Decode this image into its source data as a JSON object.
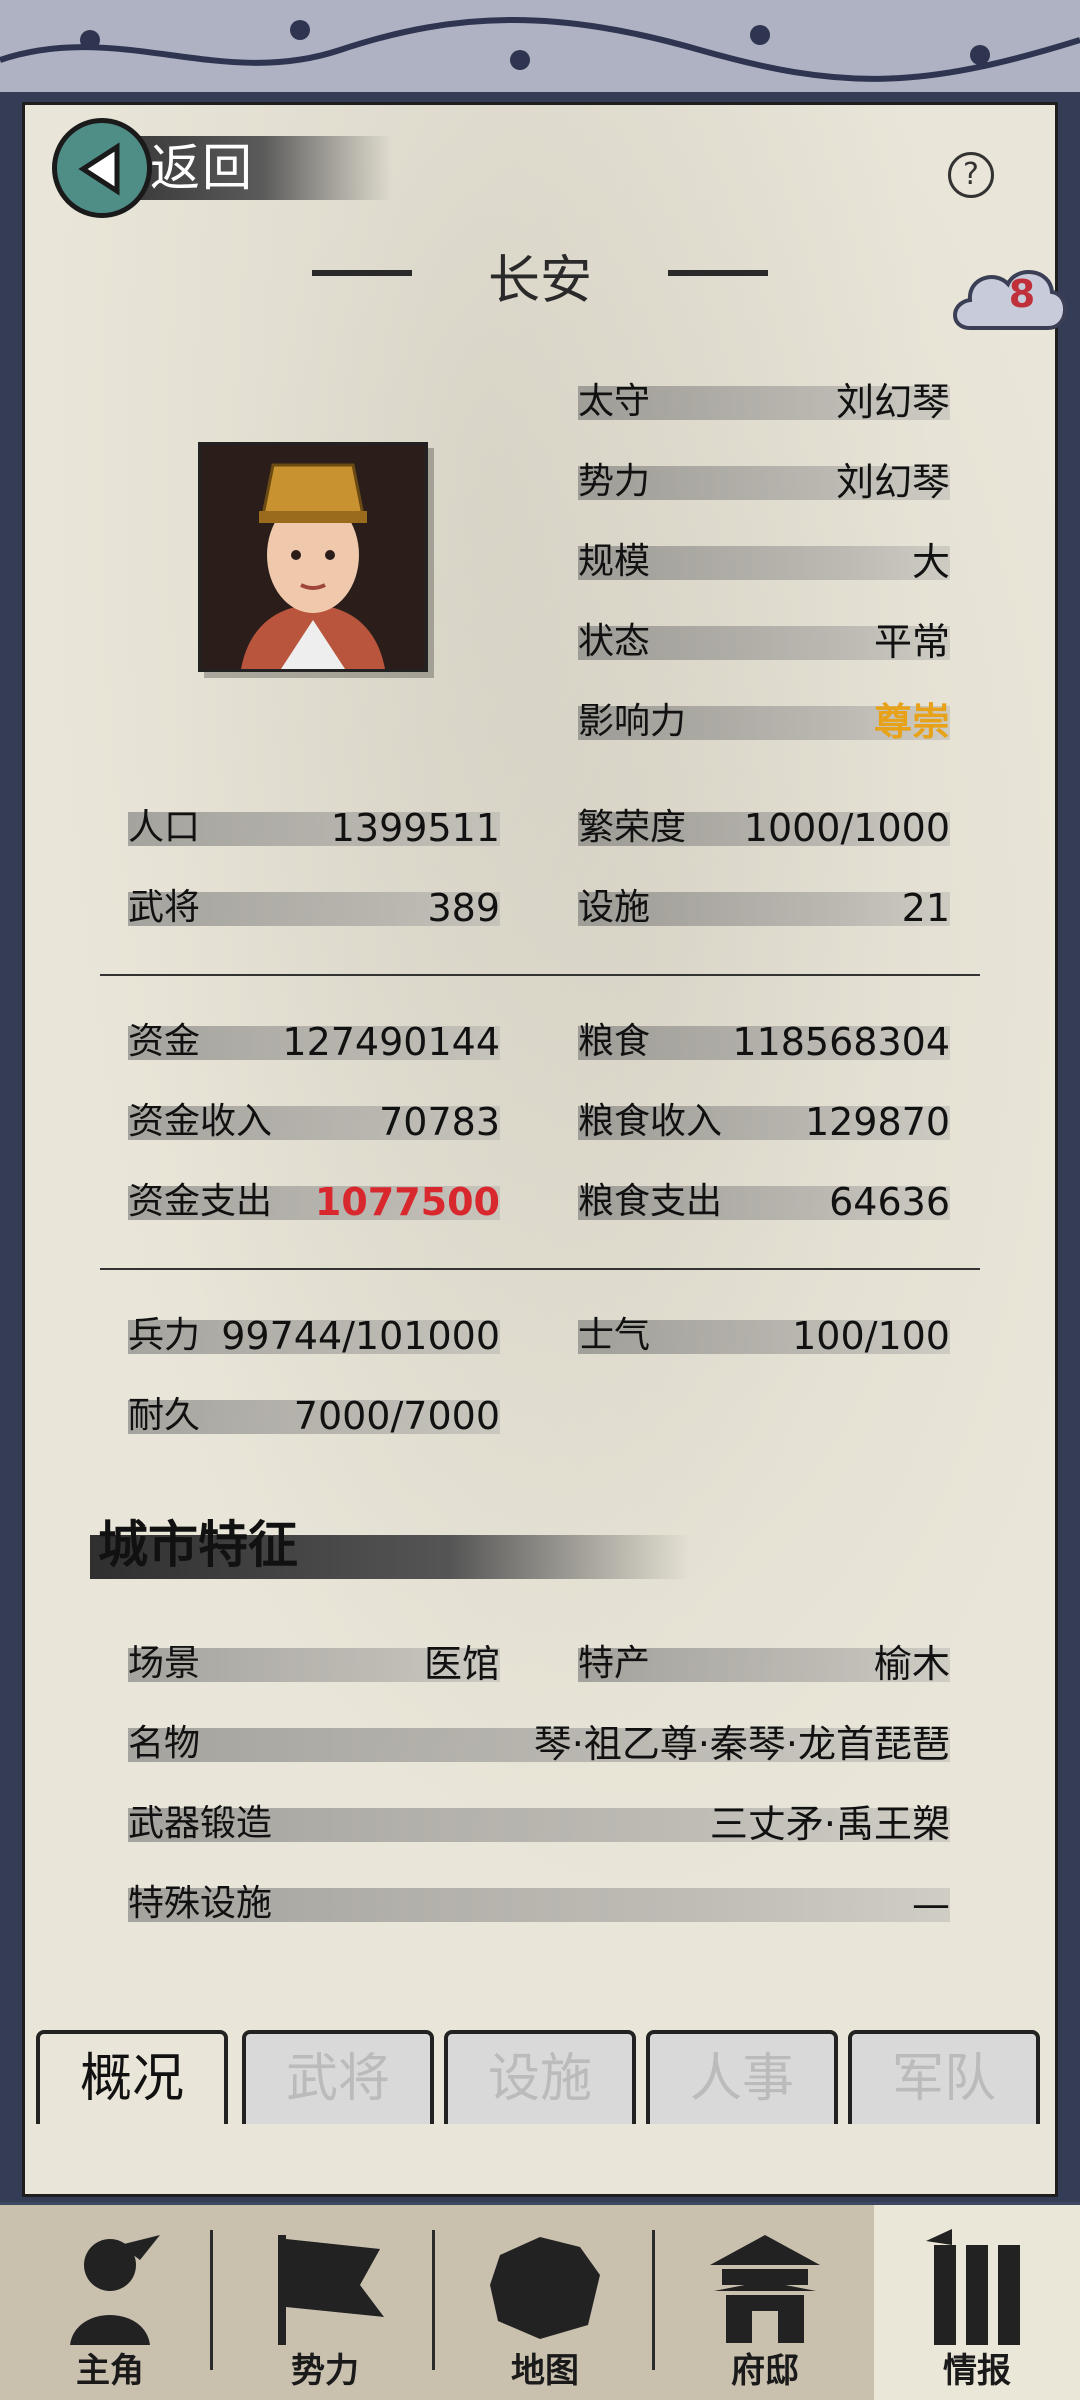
{
  "header": {
    "back_label": "返回",
    "help_label": "?",
    "city": "长安",
    "notice_count": "8"
  },
  "official": [
    {
      "label": "太守",
      "value": "刘幻琴"
    },
    {
      "label": "势力",
      "value": "刘幻琴"
    },
    {
      "label": "规模",
      "value": "大"
    },
    {
      "label": "状态",
      "value": "平常"
    },
    {
      "label": "影响力",
      "value": "尊崇"
    }
  ],
  "stats1": [
    {
      "label": "人口",
      "value": "1399511"
    },
    {
      "label": "繁荣度",
      "value": "1000/1000"
    },
    {
      "label": "武将",
      "value": "389"
    },
    {
      "label": "设施",
      "value": "21"
    }
  ],
  "stats2": [
    {
      "label": "资金",
      "value": "127490144"
    },
    {
      "label": "粮食",
      "value": "118568304"
    },
    {
      "label": "资金收入",
      "value": "70783"
    },
    {
      "label": "粮食收入",
      "value": "129870"
    },
    {
      "label": "资金支出",
      "value": "1077500"
    },
    {
      "label": "粮食支出",
      "value": "64636"
    }
  ],
  "stats3": [
    {
      "label": "兵力",
      "value": "99744/101000"
    },
    {
      "label": "士气",
      "value": "100/100"
    },
    {
      "label": "耐久",
      "value": "7000/7000"
    }
  ],
  "features": {
    "title": "城市特征",
    "rows": [
      {
        "label": "场景",
        "value": "医馆"
      },
      {
        "label": "特产",
        "value": "榆木"
      },
      {
        "label": "名物",
        "value": "琴·祖乙尊·秦琴·龙首琵琶"
      },
      {
        "label": "武器锻造",
        "value": "三丈矛·禹王槊"
      },
      {
        "label": "特殊设施",
        "value": "—"
      }
    ]
  },
  "tabs": [
    "概况",
    "武将",
    "设施",
    "人事",
    "军队"
  ],
  "nav": [
    "主角",
    "势力",
    "地图",
    "府邸",
    "情报"
  ],
  "colors": {
    "accent_red": "#d8282e",
    "gold": "#e8a219",
    "teal": "#4f8e86"
  }
}
